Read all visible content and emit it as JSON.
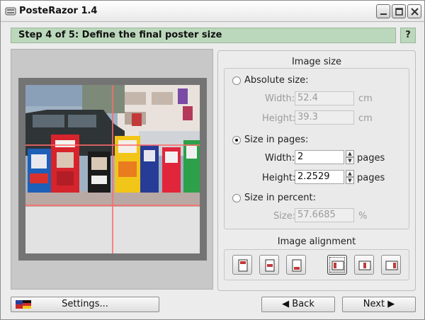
{
  "window": {
    "title": "PosteRazor 1.4"
  },
  "step": {
    "title": "Step 4 of 5: Define the final poster size",
    "help_label": "?"
  },
  "image_size": {
    "title": "Image size",
    "absolute": {
      "label": "Absolute size:",
      "width_label": "Width:",
      "width_value": "52.4",
      "width_unit": "cm",
      "height_label": "Height:",
      "height_value": "39.3",
      "height_unit": "cm",
      "selected": false
    },
    "pages": {
      "label": "Size in pages:",
      "width_label": "Width:",
      "width_value": "2",
      "width_unit": "pages",
      "height_label": "Height:",
      "height_value": "2.2529",
      "height_unit": "pages",
      "selected": true
    },
    "percent": {
      "label": "Size in percent:",
      "size_label": "Size:",
      "size_value": "57.6685",
      "size_unit": "%",
      "selected": false
    }
  },
  "alignment": {
    "title": "Image alignment",
    "buttons": [
      "align-top",
      "align-middle",
      "align-bottom",
      "align-left",
      "align-center",
      "align-right"
    ],
    "selected": "align-left"
  },
  "footer": {
    "settings_label": "Settings...",
    "back_label": "Back",
    "next_label": "Next"
  },
  "colors": {
    "step_bar": "#bcd8bc",
    "cut_lines": "#ff6b6b"
  }
}
